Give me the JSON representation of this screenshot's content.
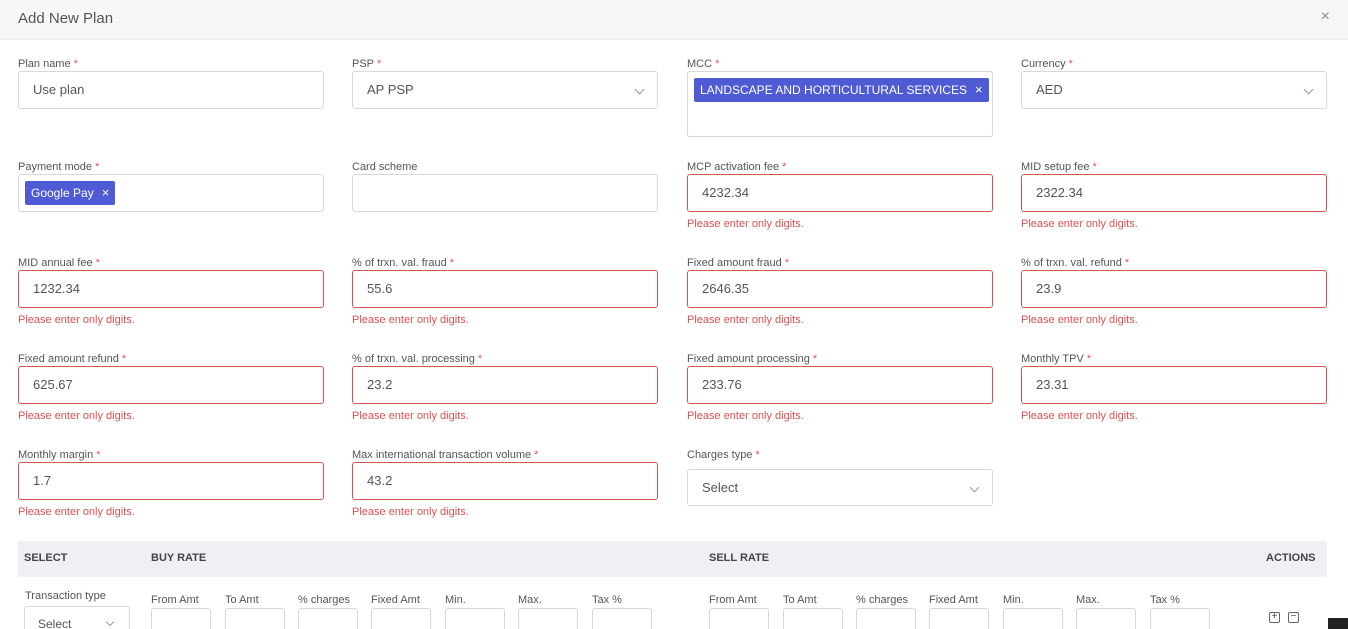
{
  "header": {
    "title": "Add New Plan",
    "close_glyph": "×"
  },
  "required_marker": "*",
  "fields": {
    "plan_name": {
      "label": "Plan name",
      "value": "Use plan"
    },
    "psp": {
      "label": "PSP",
      "value": "AP PSP"
    },
    "mcc": {
      "label": "MCC",
      "tag": "LANDSCAPE AND HORTICULTURAL SERVICES",
      "tag_remove": "×"
    },
    "currency": {
      "label": "Currency",
      "value": "AED"
    },
    "payment_mode": {
      "label": "Payment mode",
      "tag": "Google Pay",
      "tag_remove": "×"
    },
    "card_scheme": {
      "label": "Card scheme",
      "value": ""
    },
    "mcp_activation_fee": {
      "label": "MCP activation fee",
      "value": "4232.34",
      "error": "Please enter only digits."
    },
    "mid_setup_fee": {
      "label": "MID setup fee",
      "value": "2322.34",
      "error": "Please enter only digits."
    },
    "mid_annual_fee": {
      "label": "MID annual fee",
      "value": "1232.34",
      "error": "Please enter only digits."
    },
    "pct_fraud": {
      "label": "% of trxn. val. fraud",
      "value": "55.6",
      "error": "Please enter only digits."
    },
    "fixed_fraud": {
      "label": "Fixed amount fraud",
      "value": "2646.35",
      "error": "Please enter only digits."
    },
    "pct_refund": {
      "label": "% of trxn. val. refund",
      "value": "23.9",
      "error": "Please enter only digits."
    },
    "fixed_refund": {
      "label": "Fixed amount refund",
      "value": "625.67",
      "error": "Please enter only digits."
    },
    "pct_processing": {
      "label": "% of trxn. val. processing",
      "value": "23.2",
      "error": "Please enter only digits."
    },
    "fixed_processing": {
      "label": "Fixed amount processing",
      "value": "233.76",
      "error": "Please enter only digits."
    },
    "monthly_tpv": {
      "label": "Monthly TPV",
      "value": "23.31",
      "error": "Please enter only digits."
    },
    "monthly_margin": {
      "label": "Monthly margin",
      "value": "1.7",
      "error": "Please enter only digits."
    },
    "max_intl_volume": {
      "label": "Max international transaction volume",
      "value": "43.2",
      "error": "Please enter only digits."
    },
    "charges_type": {
      "label": "Charges type",
      "value": "Select"
    }
  },
  "table": {
    "headers": {
      "select": "SELECT",
      "buy_rate": "BUY RATE",
      "sell_rate": "SELL RATE",
      "actions": "ACTIONS"
    },
    "transaction_type_label": "Transaction type",
    "transaction_type_value": "Select",
    "buy_columns": [
      "From Amt",
      "To Amt",
      "% charges",
      "Fixed Amt",
      "Min.",
      "Max.",
      "Tax %"
    ],
    "sell_columns": [
      "From Amt",
      "To Amt",
      "% charges",
      "Fixed Amt",
      "Min.",
      "Max.",
      "Tax %"
    ],
    "add_glyph": "+",
    "remove_glyph": "−"
  }
}
